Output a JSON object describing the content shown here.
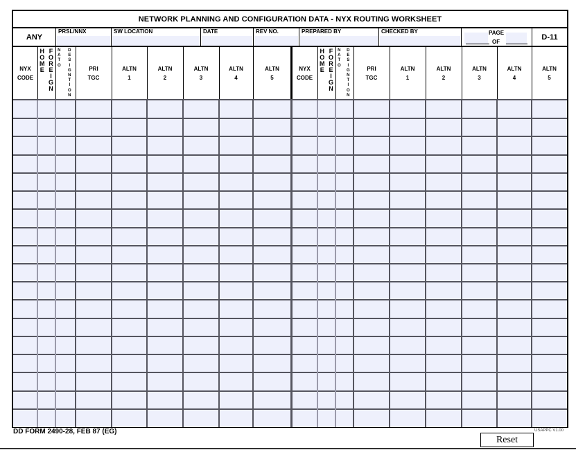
{
  "form": {
    "title": "NETWORK PLANNING AND CONFIGURATION DATA - NYX ROUTING WORKSHEET",
    "classification": "ANY",
    "form_code": "D-11",
    "footer_form_id": "DD FORM 2490-28, FEB 87 (EG)",
    "version": "USAPPC V1.00",
    "reset_label": "Reset"
  },
  "header_fields": {
    "prsl_nnx": {
      "label": "PRSL/NNX",
      "value": ""
    },
    "sw_location": {
      "label": "SW LOCATION",
      "value": ""
    },
    "date": {
      "label": "DATE",
      "value": ""
    },
    "rev_no": {
      "label": "REV NO.",
      "value": ""
    },
    "prepared_by": {
      "label": "PREPARED BY",
      "value": ""
    },
    "checked_by": {
      "label": "CHECKED BY",
      "value": ""
    },
    "page": {
      "label": "PAGE",
      "of_label": "OF",
      "page_value": "",
      "of_value": ""
    }
  },
  "columns": {
    "nyx_code": [
      "NYX",
      "CODE"
    ],
    "home": "HOME",
    "foreign": "FOREIGN",
    "nato": "NATO",
    "designation": "DESIGNTION",
    "pri_tgc": [
      "PRI",
      "TGC"
    ],
    "altn1": [
      "ALTN",
      "1"
    ],
    "altn2": [
      "ALTN",
      "2"
    ],
    "altn3": [
      "ALTN",
      "3"
    ],
    "altn4": [
      "ALTN",
      "4"
    ],
    "altn5": [
      "ALTN",
      "5"
    ]
  },
  "grid": {
    "row_count": 18,
    "fill_color": "#eef0fc",
    "line_color": "#55555f",
    "light_line_color": "#9a9aaa"
  }
}
